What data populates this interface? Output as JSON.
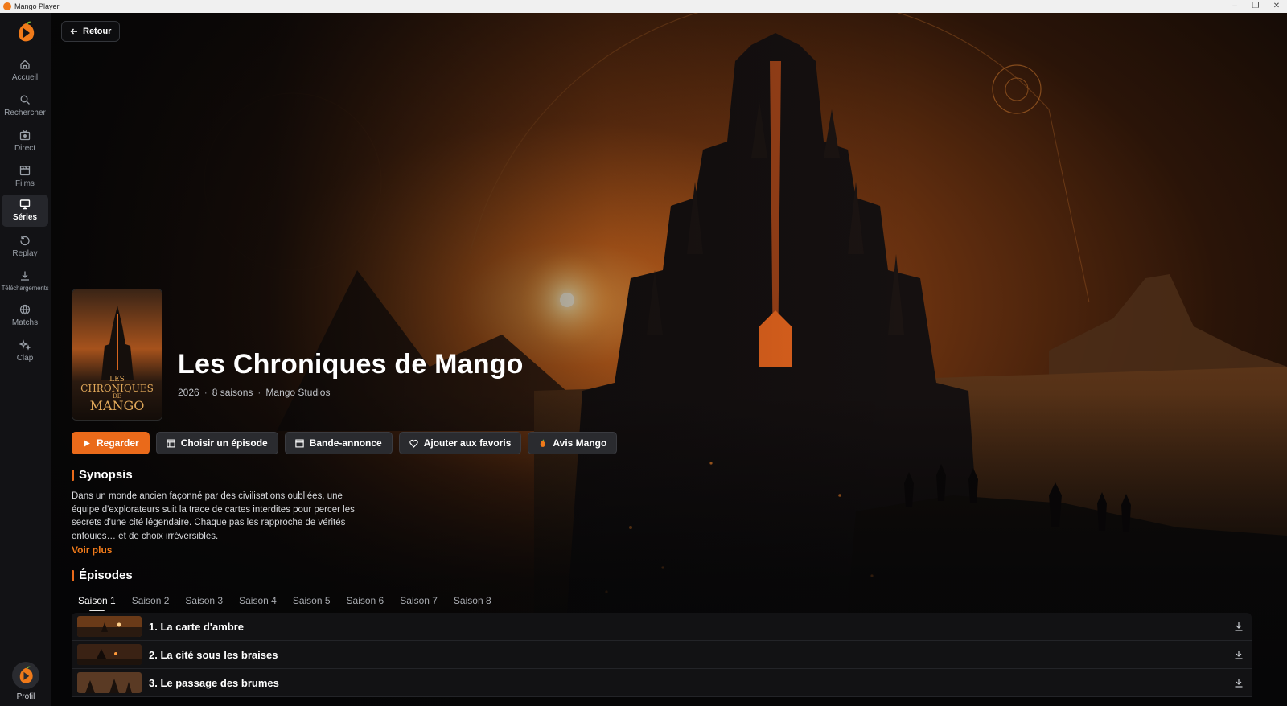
{
  "window": {
    "title": "Mango Player",
    "controls": [
      "–",
      "❐",
      "✕"
    ]
  },
  "sidebar": {
    "items": [
      {
        "label": "Accueil",
        "icon": "home-icon"
      },
      {
        "label": "Rechercher",
        "icon": "search-icon"
      },
      {
        "label": "Direct",
        "icon": "live-tv-icon"
      },
      {
        "label": "Films",
        "icon": "clapperboard-icon"
      },
      {
        "label": "Séries",
        "icon": "monitor-icon",
        "active": true
      },
      {
        "label": "Replay",
        "icon": "replay-icon"
      },
      {
        "label": "Téléchargements",
        "icon": "download-icon"
      },
      {
        "label": "Matchs",
        "icon": "globe-ball-icon"
      },
      {
        "label": "Clap",
        "icon": "sparkle-icon"
      }
    ],
    "profile_label": "Profil"
  },
  "header": {
    "back_label": "Retour"
  },
  "show": {
    "title": "Les Chroniques de Mango",
    "year": "2026",
    "seasons": "8 saisons",
    "studio": "Mango Studios",
    "poster_lines": [
      "LES",
      "CHRONIQUES",
      "DE",
      "MANGO"
    ]
  },
  "actions": {
    "watch": "Regarder",
    "choose_episode": "Choisir un épisode",
    "trailer": "Bande-annonce",
    "favorites": "Ajouter aux favoris",
    "review": "Avis Mango"
  },
  "synopsis": {
    "heading": "Synopsis",
    "text": "Dans un monde ancien façonné par des civilisations oubliées, une équipe d'explorateurs suit la trace de cartes interdites pour percer les secrets d'une cité légendaire. Chaque pas les rapproche de vérités enfouies… et de choix irréversibles.",
    "more": "Voir plus"
  },
  "episodes": {
    "heading": "Épisodes",
    "seasons": [
      "Saison 1",
      "Saison 2",
      "Saison 3",
      "Saison 4",
      "Saison 5",
      "Saison 6",
      "Saison 7",
      "Saison 8"
    ],
    "active_season": 0,
    "list": [
      {
        "title": "1. La carte d'ambre"
      },
      {
        "title": "2. La cité sous les braises"
      },
      {
        "title": "3. Le passage des brumes"
      }
    ]
  },
  "colors": {
    "accent": "#ea6a1a",
    "sidebar_bg": "#121215",
    "button_bg": "#2a2b2f"
  }
}
